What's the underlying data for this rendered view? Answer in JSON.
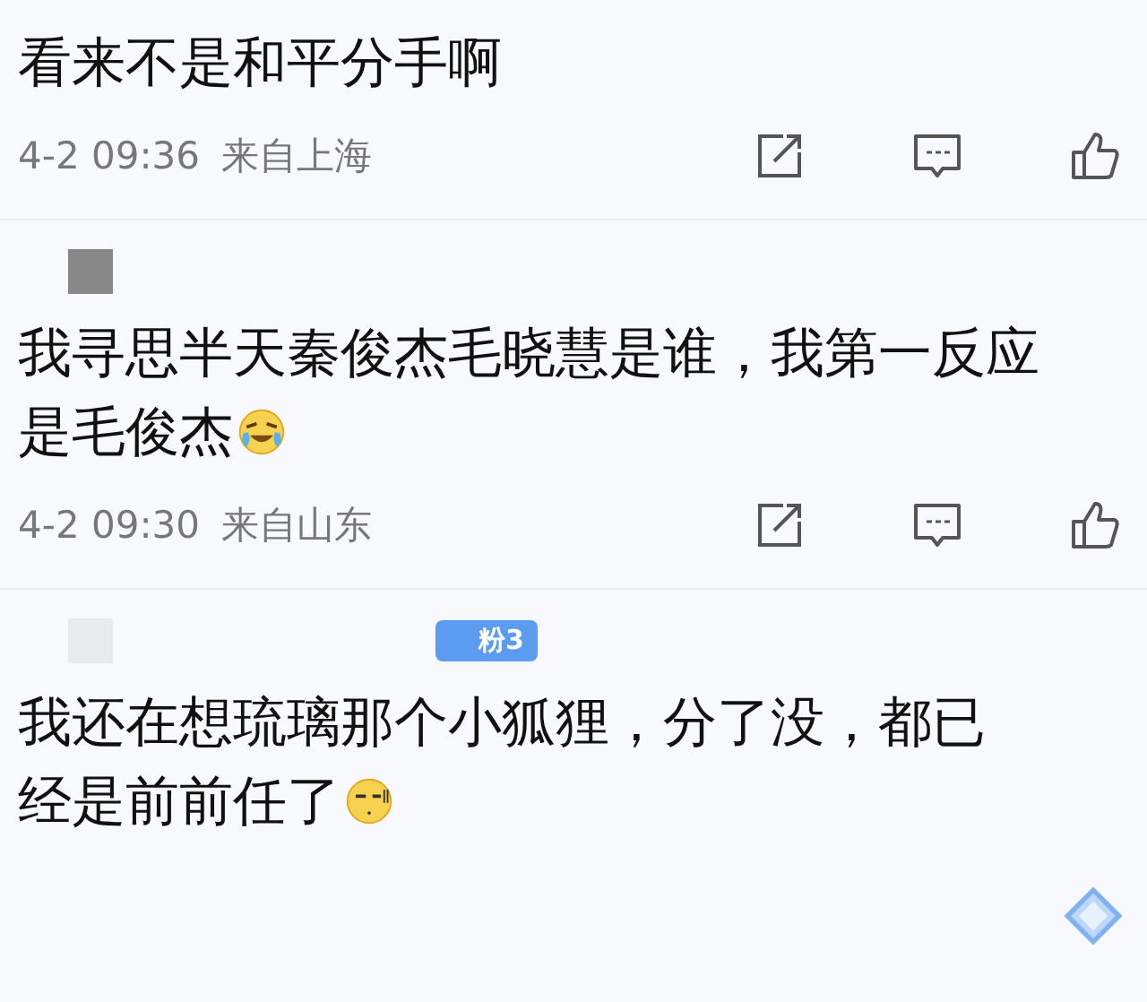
{
  "comments": [
    {
      "lines": [
        "看来不是和平分手啊"
      ],
      "time": "4-2 09:36",
      "location": "来自上海"
    },
    {
      "avatar": {
        "kind": "dark"
      },
      "lines": [
        "我寻思半天秦俊杰毛晓慧是谁，我第一反应",
        "是毛俊杰"
      ],
      "emoji": {
        "kind": "laugh"
      },
      "time": "4-2 09:30",
      "location": "来自山东"
    },
    {
      "avatar": {
        "kind": "faint"
      },
      "badge": "粉3",
      "lines": [
        "我还在想琉璃那个小狐狸，分了没，都已",
        "经是前前任了"
      ],
      "emoji": {
        "kind": "awkward"
      }
    }
  ]
}
